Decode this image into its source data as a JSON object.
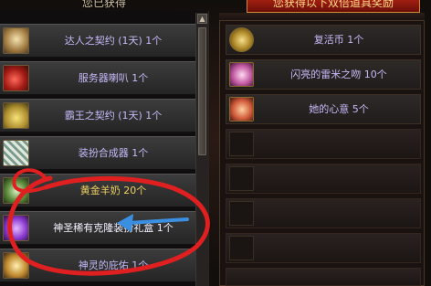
{
  "left_panel": {
    "header": "您已获得",
    "items": [
      {
        "label": "达人之契约 (1天) 1个",
        "icon": "contract-scroll-icon",
        "color": "#c6b9f8"
      },
      {
        "label": "服务器喇叭 1个",
        "icon": "megaphone-icon",
        "color": "#c6b9f8"
      },
      {
        "label": "霸王之契约 (1天) 1个",
        "icon": "overlord-contract-icon",
        "color": "#c6b9f8"
      },
      {
        "label": "装扮合成器 1个",
        "icon": "synthesizer-icon",
        "color": "#c6b9f8"
      },
      {
        "label": "黄金羊奶 20个",
        "icon": "goat-milk-icon",
        "color": "#f0d060"
      },
      {
        "label": "神圣稀有克隆装扮礼盒 1个",
        "icon": "gift-box-icon",
        "color": "#f4f1ff"
      },
      {
        "label": "神灵的庇佑 1个",
        "icon": "blessing-icon",
        "color": "#c6b9f8"
      }
    ]
  },
  "right_panel": {
    "header": "您获得以下双倍道具奖励",
    "items": [
      {
        "label": "复活币 1个",
        "icon": "revive-coin-icon"
      },
      {
        "label": "闪亮的雷米之吻 10个",
        "icon": "remy-kiss-icon"
      },
      {
        "label": "她的心意 5个",
        "icon": "heart-gift-icon"
      },
      {
        "label": "",
        "icon": "empty-slot"
      },
      {
        "label": "",
        "icon": "empty-slot"
      },
      {
        "label": "",
        "icon": "empty-slot"
      },
      {
        "label": "",
        "icon": "empty-slot"
      },
      {
        "label": "",
        "icon": "empty-slot"
      }
    ]
  },
  "annotation": {
    "color": "#e02020",
    "arrow_color": "#3a8fe0"
  }
}
